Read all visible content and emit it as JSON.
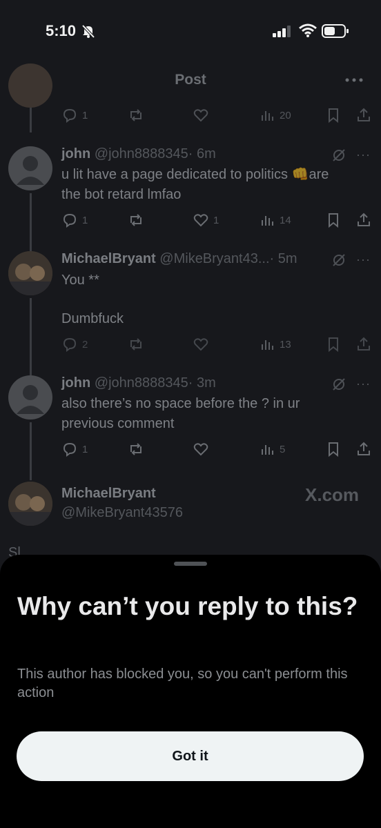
{
  "status_bar": {
    "time": "5:10"
  },
  "header": {
    "title": "Post"
  },
  "top_post_actions": {
    "replies": "1",
    "views": "20"
  },
  "replies": [
    {
      "name": "john",
      "handle": "@john8888345",
      "time": "· 6m",
      "text": "u lit have a page dedicated to politics",
      "emoji": "👊",
      "text2": "are the bot retard lmfao",
      "replies": "1",
      "likes": "1",
      "views": "14"
    },
    {
      "name": "MichaelBryant",
      "handle": "@MikeBryant43...",
      "time": "· 5m",
      "line1": "You **",
      "line2": "Dumbfuck",
      "replies": "2",
      "views": "13"
    },
    {
      "name": "john",
      "handle": "@john8888345",
      "time": "· 3m",
      "text": "also there’s no space before the ? in ur previous comment",
      "replies": "1",
      "views": "5"
    }
  ],
  "focused_post": {
    "name": "MichaelBryant",
    "handle": "@MikeBryant43576",
    "watermark": "X.com",
    "partial_text": "Sl"
  },
  "sheet": {
    "title": "Why can’t you reply to this?",
    "description": "This author has blocked you, so you can't perform this action",
    "button": "Got it"
  }
}
